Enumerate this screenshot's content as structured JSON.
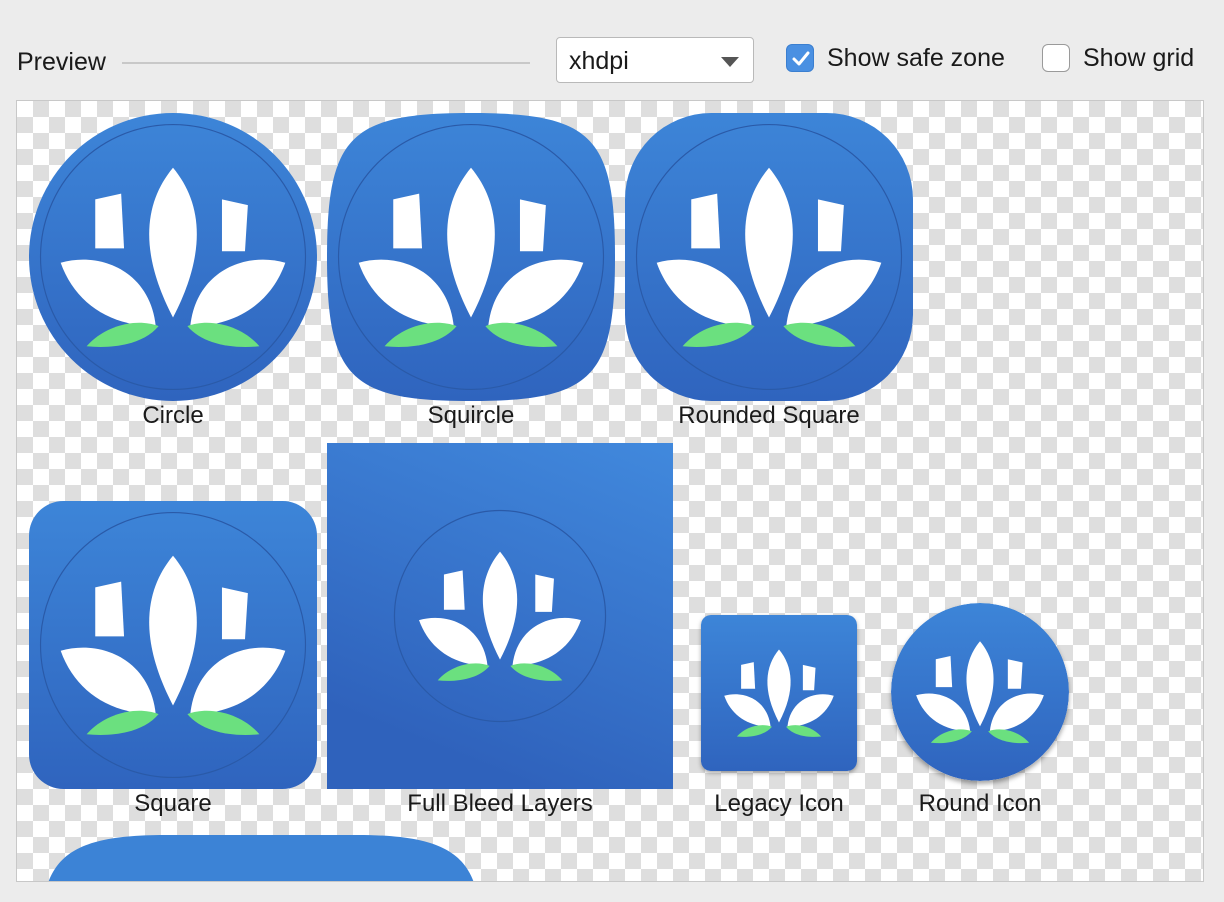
{
  "header": {
    "preview_label": "Preview",
    "density_value": "xhdpi",
    "show_safe_zone_label": "Show safe zone",
    "show_safe_zone_checked": true,
    "show_grid_label": "Show grid",
    "show_grid_checked": false
  },
  "colors": {
    "accent": "#4a90e2",
    "icon_blue_top": "#3d85d8",
    "icon_blue_bottom": "#2f64be",
    "leaf_green": "#6be07f"
  },
  "icons": [
    {
      "shape": "circle",
      "caption": "Circle"
    },
    {
      "shape": "squircle",
      "caption": "Squircle"
    },
    {
      "shape": "rounded-square",
      "caption": "Rounded Square"
    },
    {
      "shape": "square",
      "caption": "Square"
    },
    {
      "shape": "full-bleed",
      "caption": "Full Bleed Layers"
    },
    {
      "shape": "legacy",
      "caption": "Legacy Icon"
    },
    {
      "shape": "round",
      "caption": "Round Icon"
    }
  ]
}
